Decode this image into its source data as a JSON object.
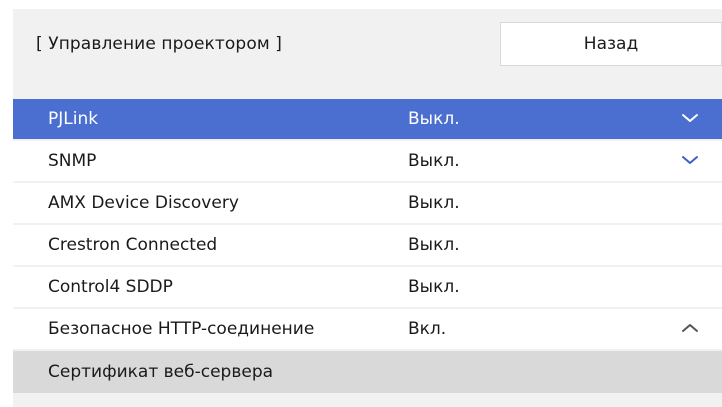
{
  "header": {
    "title": "[ Управление проектором ]",
    "back_label": "Назад"
  },
  "rows": [
    {
      "label": "PJLink",
      "value": "Выкл.",
      "icon": "chevron-down-icon",
      "selected": true
    },
    {
      "label": "SNMP",
      "value": "Выкл.",
      "icon": "chevron-down-icon"
    },
    {
      "label": "AMX Device Discovery",
      "value": "Выкл."
    },
    {
      "label": "Crestron Connected",
      "value": "Выкл."
    },
    {
      "label": "Control4 SDDP",
      "value": "Выкл."
    },
    {
      "label": "Безопасное HTTP-соединение",
      "value": "Вкл.",
      "icon": "chevron-up-icon"
    }
  ],
  "sub_item": {
    "label": "Сертификат веб-сервера"
  },
  "colors": {
    "selected_row": "#4a6fd0",
    "panel_background": "#f1f1f1",
    "sub_item_background": "#d9d9d9",
    "chevron": "#3a5fc8"
  }
}
